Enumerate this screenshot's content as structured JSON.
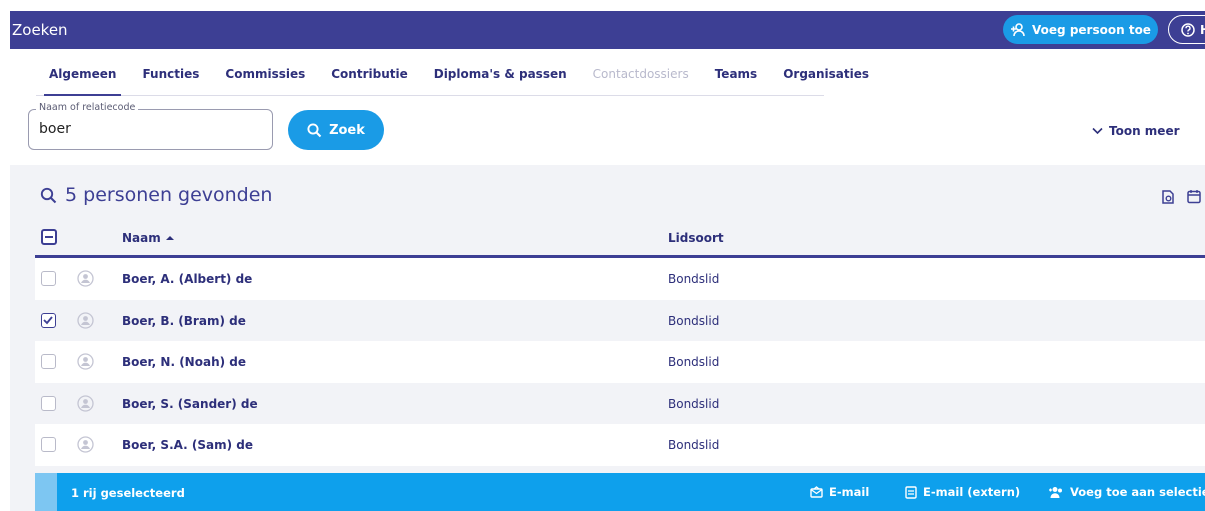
{
  "header": {
    "title": "Zoeken",
    "add_person_label": "Voeg persoon toe",
    "help_label": "He"
  },
  "tabs": [
    {
      "label": "Algemeen",
      "active": true
    },
    {
      "label": "Functies"
    },
    {
      "label": "Commissies"
    },
    {
      "label": "Contributie"
    },
    {
      "label": "Diploma's & passen"
    },
    {
      "label": "Contactdossiers",
      "disabled": true
    },
    {
      "label": "Teams"
    },
    {
      "label": "Organisaties"
    }
  ],
  "search": {
    "label": "Naam of relatiecode",
    "value": "boer",
    "button_label": "Zoek",
    "toon_meer_label": "Toon meer"
  },
  "results": {
    "title": "5 personen gevonden",
    "columns": {
      "name": "Naam",
      "type": "Lidsoort"
    },
    "rows": [
      {
        "name": "Boer, A. (Albert) de",
        "type": "Bondslid",
        "checked": false
      },
      {
        "name": "Boer, B. (Bram) de",
        "type": "Bondslid",
        "checked": true
      },
      {
        "name": "Boer, N. (Noah) de",
        "type": "Bondslid",
        "checked": false
      },
      {
        "name": "Boer, S. (Sander) de",
        "type": "Bondslid",
        "checked": false
      },
      {
        "name": "Boer, S.A. (Sam) de",
        "type": "Bondslid",
        "checked": false
      }
    ]
  },
  "footer": {
    "selected_label": "1 rij geselecteerd",
    "email_label": "E-mail",
    "email_extern_label": "E-mail (extern)",
    "add_selection_label": "Voeg toe aan selectie"
  },
  "colors": {
    "primary": "#3d3f94",
    "accent": "#1a9be6",
    "footer": "#0ea0ec"
  },
  "icons": [
    "add-person-icon",
    "help-icon",
    "search-icon",
    "chevron-down-icon",
    "export-icon",
    "calendar-icon",
    "avatar-icon",
    "checkmark-icon",
    "sort-up-icon",
    "email-icon",
    "email-extern-icon",
    "add-selection-icon"
  ]
}
